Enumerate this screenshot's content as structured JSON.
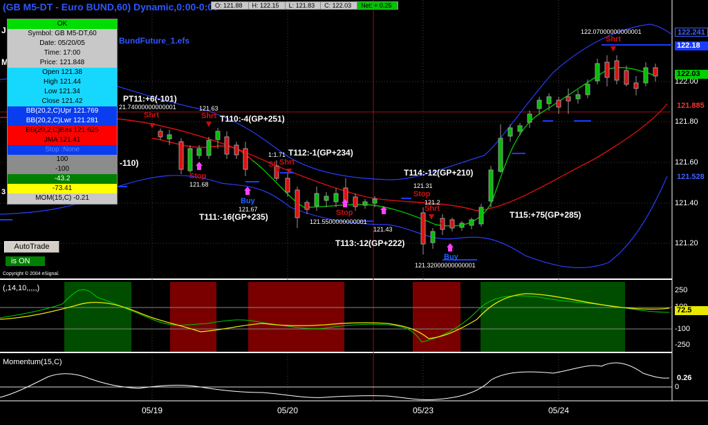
{
  "title": "(GB M5-DT - Euro BUND,60) Dynamic,0:00-0:00",
  "ohlc": {
    "open": "O: 121.88",
    "high": "H: 122.15",
    "low": "L: 121.83",
    "close": "C: 122.03",
    "net": "Net: + 0.25"
  },
  "data_window": {
    "status": "OK",
    "symbol": "Symbol: GB M5-DT,60",
    "date": "Date: 05/20/05",
    "time": "Time: 17:00",
    "price": "Price: 121.848",
    "open": "Open 121.38",
    "high": "High 121.44",
    "low": "Low 121.34",
    "close": "Close 121.42",
    "bb_upr": "BB(20,2,C)Upr 121.769",
    "bb_lwr": "BB(20,2,C)Lwr 121.281",
    "bb_bas": "BB(20,2,C)Bas 121.625",
    "jma": "JMA 121.41",
    "stop": "Stop :None",
    "v100": "100",
    "vneg100": "-100",
    "v432": "-43.2",
    "v7341": "-73.41",
    "mom": "MOM(15,C) -0.21"
  },
  "autotrade": {
    "button_label": "AutoTrade",
    "status": "is ON"
  },
  "copyright": "Copyright © 2004 eSignal.",
  "file_label": "BundFuture_1.efs",
  "oscillator_title": "(,14,10,,,,,)",
  "momentum_title": "Momentum(15,C)",
  "partial_labels": {
    "j": "J",
    "m": "M",
    "b110": "-110)",
    "three": "3"
  },
  "price_axis": {
    "ticks": [
      "122.00",
      "121.80",
      "121.60",
      "121.40",
      "121.20"
    ],
    "upper_band": "122.241",
    "blue_line": "122.18",
    "last": "122.03",
    "red_line": "121.885",
    "lower_band": "121.528"
  },
  "osc_axis": {
    "ticks": [
      "250",
      "100",
      "-100",
      "-250"
    ],
    "value": "72.5"
  },
  "mom_axis": {
    "ticks": [
      "0"
    ],
    "value": "0.26"
  },
  "dates": [
    "05/19",
    "05/20",
    "05/23",
    "05/24"
  ],
  "trades": {
    "pt11": "PT11:+6(-101)",
    "t110": "T110:-4(GP+251)",
    "t111": "T111:-16(GP+235)",
    "t112": "T112:-1(GP+234)",
    "t113": "T113:-12(GP+222)",
    "t114": "T114:-12(GP+210)",
    "t115": "T115:+75(GP+285)"
  },
  "price_labels": {
    "p1": "21.74000000000001",
    "p2": "121.63",
    "p3": "121.68",
    "p4": "121.67",
    "p5": "1:1.71",
    "p6": "121.5500000000001",
    "p7": "121.43",
    "p8": "121.31",
    "p9": "121.2",
    "p10": "121.32000000000001",
    "p11": "122.07000000000001"
  },
  "signals": {
    "shrt": "Shrt",
    "stop": "Stop",
    "buy": "Buy",
    "st": "St"
  },
  "colors": {
    "background": "#000000",
    "title": "#2f56ff",
    "bollinger": "#2a3cff",
    "basis": "#d81010",
    "jma": "#00c000",
    "stop_dash": "#1a3cff",
    "green_zone": "#004d00",
    "red_zone": "#7a0000"
  }
}
